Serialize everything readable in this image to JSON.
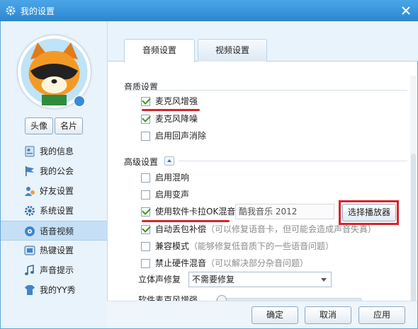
{
  "window": {
    "title": "我的设置"
  },
  "profile": {
    "avatar_button": "头像",
    "card_button": "名片"
  },
  "nav": [
    {
      "label": "我的信息",
      "icon": "id-card-icon"
    },
    {
      "label": "我的公会",
      "icon": "flag-icon"
    },
    {
      "label": "好友设置",
      "icon": "friends-icon"
    },
    {
      "label": "系统设置",
      "icon": "gear-icon"
    },
    {
      "label": "语音视频",
      "icon": "speaker-icon",
      "active": true
    },
    {
      "label": "热键设置",
      "icon": "keyboard-icon"
    },
    {
      "label": "声音提示",
      "icon": "music-note-icon"
    },
    {
      "label": "我的YY秀",
      "icon": "shirt-icon"
    }
  ],
  "tabs": [
    {
      "label": "音频设置",
      "active": true
    },
    {
      "label": "视频设置",
      "active": false
    }
  ],
  "quality": {
    "title": "音质设置",
    "items": [
      {
        "label": "麦克风增强",
        "checked": true
      },
      {
        "label": "麦克风降噪",
        "checked": true
      },
      {
        "label": "启用回声消除",
        "checked": false
      }
    ]
  },
  "advanced": {
    "title": "高级设置",
    "reverb": {
      "label": "启用混响",
      "checked": false
    },
    "voice_change": {
      "label": "启用变声",
      "checked": false
    },
    "karaoke": {
      "label": "使用软件卡拉OK混音",
      "checked": true,
      "device": "酷我音乐 2012",
      "choose_button": "选择播放器"
    },
    "packet_loss": {
      "label": "自动丢包补偿",
      "hint": "（可以修复语音卡，但可能会造成声音失真）",
      "checked": true
    },
    "compat": {
      "label": "兼容模式",
      "hint": "（能够修复低音质下的一些语音问题）",
      "checked": false
    },
    "hw_mix": {
      "label": "禁止硬件混音",
      "hint": "（可以解决部分杂音问题）",
      "checked": false
    },
    "stereo": {
      "label": "立体声修复",
      "selected": "不需要修复"
    },
    "mic_boost": {
      "label": "软件麦克风增强",
      "level": 0
    }
  },
  "footer": {
    "ok": "确定",
    "cancel": "取消",
    "apply": "应用"
  },
  "colors": {
    "title_bar": "#2d86d0",
    "highlight": "#d8232a",
    "check": "#3a9a2e"
  }
}
